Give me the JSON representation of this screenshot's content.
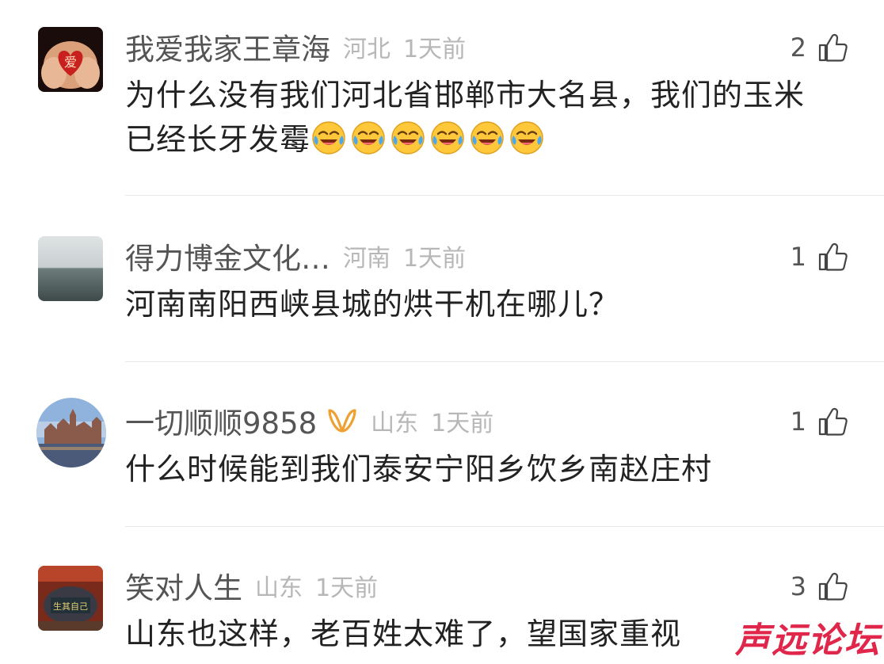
{
  "comments": [
    {
      "username": "我爱我家王章海",
      "location": "河北",
      "time": "1天前",
      "likes": "2",
      "text_line1": "为什么没有我们河北省邯郸市大名县，我们的玉米",
      "text_line2": "已经长牙发霉",
      "emoji_count": 6,
      "emoji_name": "crying-laughing-emoji"
    },
    {
      "username": "得力博金文化…",
      "location": "河南",
      "time": "1天前",
      "likes": "1",
      "text_line1": "河南南阳西峡县城的烘干机在哪儿？"
    },
    {
      "username": "一切顺顺9858",
      "vip_badge": "vip-icon",
      "location": "山东",
      "time": "1天前",
      "likes": "1",
      "text_line1": "什么时候能到我们泰安宁阳乡饮乡南赵庄村"
    },
    {
      "username": "笑对人生",
      "location": "山东",
      "time": "1天前",
      "likes": "3",
      "text_line1": "山东也这样，老百姓太难了，望国家重视"
    }
  ],
  "watermark": "声远论坛",
  "colors": {
    "username": "#555555",
    "meta": "#b7b7b7",
    "text": "#222222",
    "divider": "#e8e8e8",
    "watermark": "#e0264a",
    "vip_badge": "#f0a030"
  }
}
